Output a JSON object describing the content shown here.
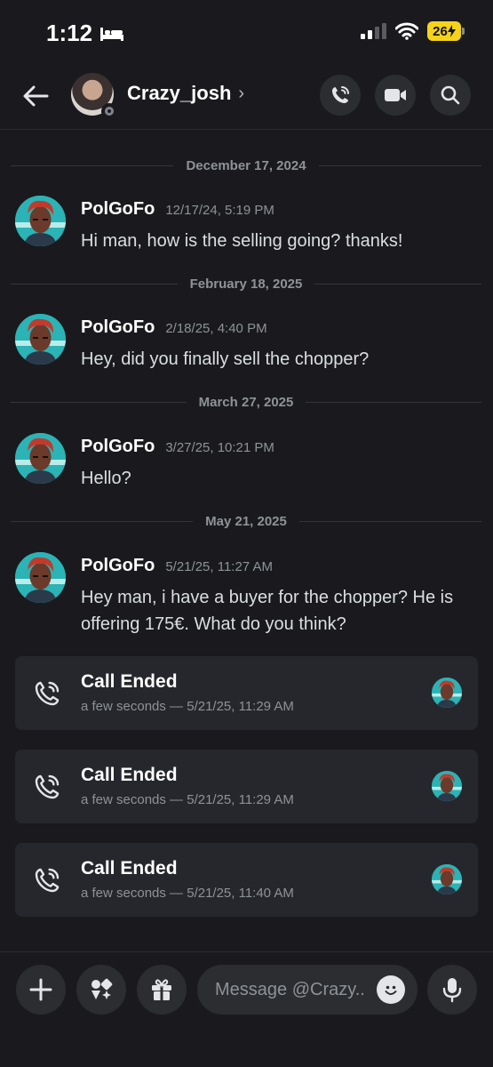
{
  "status_bar": {
    "time": "1:12",
    "battery": "26"
  },
  "header": {
    "username": "Crazy_josh",
    "chevron": "›"
  },
  "messages": [
    {
      "date_separator": "December 17, 2024",
      "author": "PolGoFo",
      "timestamp": "12/17/24, 5:19 PM",
      "text": "Hi man, how is the selling going? thanks!"
    },
    {
      "date_separator": "February 18, 2025",
      "author": "PolGoFo",
      "timestamp": "2/18/25, 4:40 PM",
      "text": "Hey, did you finally sell the chopper?"
    },
    {
      "date_separator": "March 27, 2025",
      "author": "PolGoFo",
      "timestamp": "3/27/25, 10:21 PM",
      "text": "Hello?"
    },
    {
      "date_separator": "May 21, 2025",
      "author": "PolGoFo",
      "timestamp": "5/21/25, 11:27 AM",
      "text": "Hey man, i have a buyer for the chopper? He is offering 175€. What do you think?"
    }
  ],
  "calls": [
    {
      "title": "Call Ended",
      "detail": "a few seconds — 5/21/25, 11:29 AM"
    },
    {
      "title": "Call Ended",
      "detail": "a few seconds — 5/21/25, 11:29 AM"
    },
    {
      "title": "Call Ended",
      "detail": "a few seconds — 5/21/25, 11:40 AM"
    }
  ],
  "composer": {
    "placeholder": "Message @Crazy.."
  },
  "icons": {
    "back": "arrow-left-icon",
    "voice_call": "phone-icon",
    "video_call": "video-camera-icon",
    "search": "search-icon",
    "add": "plus-icon",
    "apps": "apps-icon",
    "gift": "gift-icon",
    "emoji": "emoji-icon",
    "mic": "microphone-icon",
    "call_log": "phone-icon"
  },
  "colors": {
    "background": "#1a1a1e",
    "card": "#26272c",
    "button": "#2b2d31",
    "muted_text": "#8e9297",
    "battery": "#f5d31b"
  }
}
